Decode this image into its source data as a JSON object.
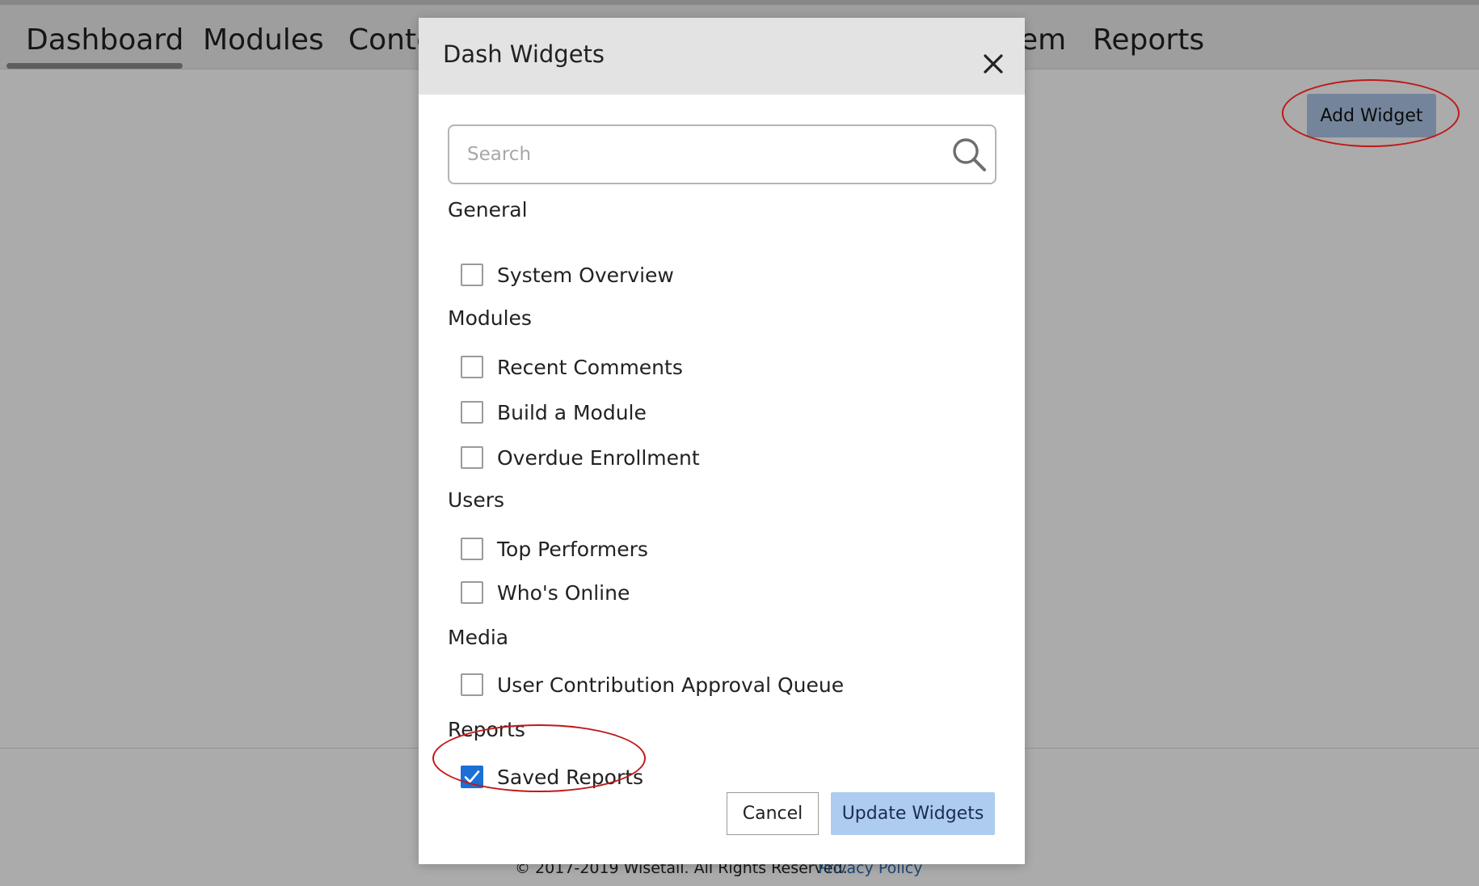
{
  "nav": {
    "tabs": [
      {
        "label": "Dashboard"
      },
      {
        "label": "Modules"
      },
      {
        "label": "Conte"
      },
      {
        "label": "em"
      },
      {
        "label": "Reports"
      }
    ]
  },
  "page": {
    "add_widget_label": "Add Widget"
  },
  "footer": {
    "copyright": "© 2017-2019 Wisetail. All Rights Reserved.",
    "privacy": "Privacy Policy"
  },
  "modal": {
    "title": "Dash Widgets",
    "search": {
      "placeholder": "Search",
      "value": ""
    },
    "groups": [
      {
        "label": "General",
        "items": [
          {
            "label": "System Overview",
            "checked": false
          }
        ]
      },
      {
        "label": "Modules",
        "items": [
          {
            "label": "Recent Comments",
            "checked": false
          },
          {
            "label": "Build a Module",
            "checked": false
          },
          {
            "label": "Overdue Enrollment",
            "checked": false
          }
        ]
      },
      {
        "label": "Users",
        "items": [
          {
            "label": "Top Performers",
            "checked": false
          },
          {
            "label": "Who's Online",
            "checked": false
          }
        ]
      },
      {
        "label": "Media",
        "items": [
          {
            "label": "User Contribution Approval Queue",
            "checked": false
          }
        ]
      },
      {
        "label": "Reports",
        "items": [
          {
            "label": "Saved Reports",
            "checked": true
          }
        ]
      }
    ],
    "cancel_label": "Cancel",
    "update_label": "Update Widgets"
  },
  "colors": {
    "annotation": "#c01818",
    "checkbox_checked": "#1c6fd6",
    "primary_button": "#aecbf0"
  }
}
